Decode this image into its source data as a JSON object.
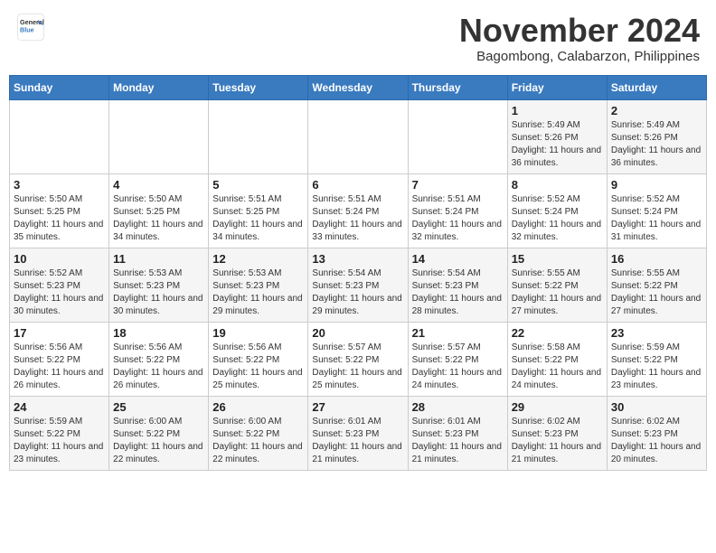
{
  "header": {
    "logo_general": "General",
    "logo_blue": "Blue",
    "month_title": "November 2024",
    "location": "Bagombong, Calabarzon, Philippines"
  },
  "weekdays": [
    "Sunday",
    "Monday",
    "Tuesday",
    "Wednesday",
    "Thursday",
    "Friday",
    "Saturday"
  ],
  "weeks": [
    [
      {
        "day": "",
        "info": ""
      },
      {
        "day": "",
        "info": ""
      },
      {
        "day": "",
        "info": ""
      },
      {
        "day": "",
        "info": ""
      },
      {
        "day": "",
        "info": ""
      },
      {
        "day": "1",
        "info": "Sunrise: 5:49 AM\nSunset: 5:26 PM\nDaylight: 11 hours and 36 minutes."
      },
      {
        "day": "2",
        "info": "Sunrise: 5:49 AM\nSunset: 5:26 PM\nDaylight: 11 hours and 36 minutes."
      }
    ],
    [
      {
        "day": "3",
        "info": "Sunrise: 5:50 AM\nSunset: 5:25 PM\nDaylight: 11 hours and 35 minutes."
      },
      {
        "day": "4",
        "info": "Sunrise: 5:50 AM\nSunset: 5:25 PM\nDaylight: 11 hours and 34 minutes."
      },
      {
        "day": "5",
        "info": "Sunrise: 5:51 AM\nSunset: 5:25 PM\nDaylight: 11 hours and 34 minutes."
      },
      {
        "day": "6",
        "info": "Sunrise: 5:51 AM\nSunset: 5:24 PM\nDaylight: 11 hours and 33 minutes."
      },
      {
        "day": "7",
        "info": "Sunrise: 5:51 AM\nSunset: 5:24 PM\nDaylight: 11 hours and 32 minutes."
      },
      {
        "day": "8",
        "info": "Sunrise: 5:52 AM\nSunset: 5:24 PM\nDaylight: 11 hours and 32 minutes."
      },
      {
        "day": "9",
        "info": "Sunrise: 5:52 AM\nSunset: 5:24 PM\nDaylight: 11 hours and 31 minutes."
      }
    ],
    [
      {
        "day": "10",
        "info": "Sunrise: 5:52 AM\nSunset: 5:23 PM\nDaylight: 11 hours and 30 minutes."
      },
      {
        "day": "11",
        "info": "Sunrise: 5:53 AM\nSunset: 5:23 PM\nDaylight: 11 hours and 30 minutes."
      },
      {
        "day": "12",
        "info": "Sunrise: 5:53 AM\nSunset: 5:23 PM\nDaylight: 11 hours and 29 minutes."
      },
      {
        "day": "13",
        "info": "Sunrise: 5:54 AM\nSunset: 5:23 PM\nDaylight: 11 hours and 29 minutes."
      },
      {
        "day": "14",
        "info": "Sunrise: 5:54 AM\nSunset: 5:23 PM\nDaylight: 11 hours and 28 minutes."
      },
      {
        "day": "15",
        "info": "Sunrise: 5:55 AM\nSunset: 5:22 PM\nDaylight: 11 hours and 27 minutes."
      },
      {
        "day": "16",
        "info": "Sunrise: 5:55 AM\nSunset: 5:22 PM\nDaylight: 11 hours and 27 minutes."
      }
    ],
    [
      {
        "day": "17",
        "info": "Sunrise: 5:56 AM\nSunset: 5:22 PM\nDaylight: 11 hours and 26 minutes."
      },
      {
        "day": "18",
        "info": "Sunrise: 5:56 AM\nSunset: 5:22 PM\nDaylight: 11 hours and 26 minutes."
      },
      {
        "day": "19",
        "info": "Sunrise: 5:56 AM\nSunset: 5:22 PM\nDaylight: 11 hours and 25 minutes."
      },
      {
        "day": "20",
        "info": "Sunrise: 5:57 AM\nSunset: 5:22 PM\nDaylight: 11 hours and 25 minutes."
      },
      {
        "day": "21",
        "info": "Sunrise: 5:57 AM\nSunset: 5:22 PM\nDaylight: 11 hours and 24 minutes."
      },
      {
        "day": "22",
        "info": "Sunrise: 5:58 AM\nSunset: 5:22 PM\nDaylight: 11 hours and 24 minutes."
      },
      {
        "day": "23",
        "info": "Sunrise: 5:59 AM\nSunset: 5:22 PM\nDaylight: 11 hours and 23 minutes."
      }
    ],
    [
      {
        "day": "24",
        "info": "Sunrise: 5:59 AM\nSunset: 5:22 PM\nDaylight: 11 hours and 23 minutes."
      },
      {
        "day": "25",
        "info": "Sunrise: 6:00 AM\nSunset: 5:22 PM\nDaylight: 11 hours and 22 minutes."
      },
      {
        "day": "26",
        "info": "Sunrise: 6:00 AM\nSunset: 5:22 PM\nDaylight: 11 hours and 22 minutes."
      },
      {
        "day": "27",
        "info": "Sunrise: 6:01 AM\nSunset: 5:23 PM\nDaylight: 11 hours and 21 minutes."
      },
      {
        "day": "28",
        "info": "Sunrise: 6:01 AM\nSunset: 5:23 PM\nDaylight: 11 hours and 21 minutes."
      },
      {
        "day": "29",
        "info": "Sunrise: 6:02 AM\nSunset: 5:23 PM\nDaylight: 11 hours and 21 minutes."
      },
      {
        "day": "30",
        "info": "Sunrise: 6:02 AM\nSunset: 5:23 PM\nDaylight: 11 hours and 20 minutes."
      }
    ]
  ]
}
